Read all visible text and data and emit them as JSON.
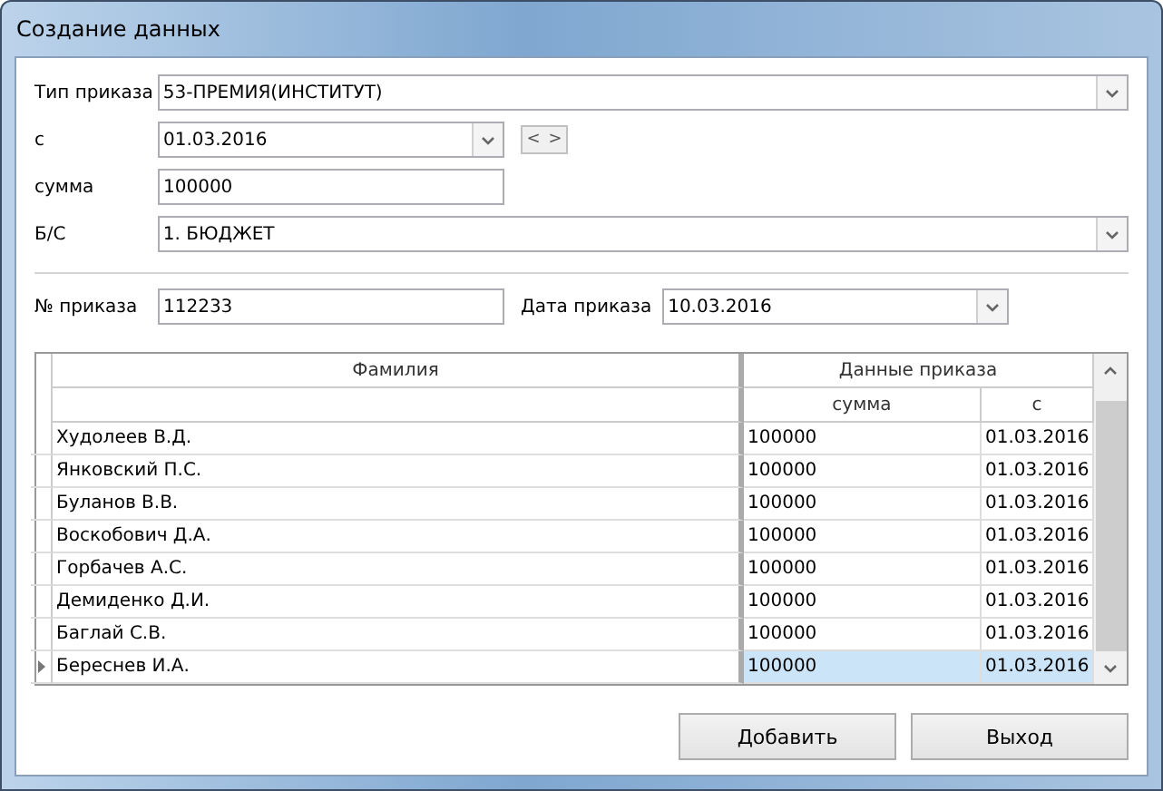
{
  "window": {
    "title": "Создание данных"
  },
  "form": {
    "order_type": {
      "label": "Тип приказа",
      "value": "53-ПРЕМИЯ(ИНСТИТУТ)"
    },
    "from": {
      "label": "с",
      "value": "01.03.2016",
      "prev": "<",
      "next": ">"
    },
    "sum": {
      "label": "сумма",
      "value": "100000"
    },
    "bs": {
      "label": "Б/С",
      "value": "1. БЮДЖЕТ"
    },
    "order_no": {
      "label": "№ приказа",
      "value": "112233"
    },
    "order_date": {
      "label": "Дата приказа",
      "value": "10.03.2016"
    }
  },
  "table": {
    "columns": {
      "name": "Фамилия",
      "group": "Данные приказа",
      "sum": "сумма",
      "from": "с"
    },
    "rows": [
      {
        "name": "Худолеев В.Д.",
        "sum": "100000",
        "from": "01.03.2016",
        "selected": false
      },
      {
        "name": "Янковский П.С.",
        "sum": "100000",
        "from": "01.03.2016",
        "selected": false
      },
      {
        "name": "Буланов В.В.",
        "sum": "100000",
        "from": "01.03.2016",
        "selected": false
      },
      {
        "name": "Воскобович Д.А.",
        "sum": "100000",
        "from": "01.03.2016",
        "selected": false
      },
      {
        "name": "Горбачев А.С.",
        "sum": "100000",
        "from": "01.03.2016",
        "selected": false
      },
      {
        "name": "Демиденко Д.И.",
        "sum": "100000",
        "from": "01.03.2016",
        "selected": false
      },
      {
        "name": "Баглай С.В.",
        "sum": "100000",
        "from": "01.03.2016",
        "selected": false
      },
      {
        "name": "Береснев И.А.",
        "sum": "100000",
        "from": "01.03.2016",
        "selected": true
      }
    ]
  },
  "buttons": [
    "Добавить",
    "Выход"
  ]
}
